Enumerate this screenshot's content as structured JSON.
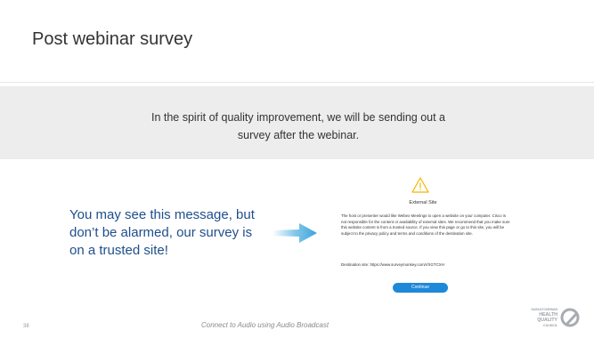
{
  "slide": {
    "title": "Post webinar survey",
    "banner_text": "In the spirit of quality improvement, we will be sending out a survey after the webinar.",
    "left_message": "You may see this message, but don’t be alarmed, our survey is on a trusted site!",
    "page_number": "38",
    "footer": "Connect to Audio using Audio Broadcast"
  },
  "dialog": {
    "title": "External Site",
    "body": "The host or presenter would like Webex Meetings to open a website on your computer. Cisco is not responsible for the content or availability of external sites. We recommend that you make sure this website content is from a trusted source. If you view this page or go to this site, you will be subject to the privacy policy and terms and conditions of the destination site.",
    "destination_label": "Destination site:",
    "destination_url": "https://www.surveymonkey.com/r/XGTCXH",
    "continue_label": "Continue"
  },
  "logo": {
    "line1": "SASKATCHEWAN",
    "line2": "HEALTH",
    "line3": "QUALITY",
    "line4": "COUNCIL"
  },
  "colors": {
    "accent_text": "#1f4e8c",
    "arrow": "#4fb0e0",
    "button": "#1e88d9",
    "band": "#ededed",
    "warning": "#f2b600"
  },
  "icons": {
    "arrow": "right-arrow-icon",
    "warning": "warning-icon",
    "logo": "q-logo-icon"
  }
}
